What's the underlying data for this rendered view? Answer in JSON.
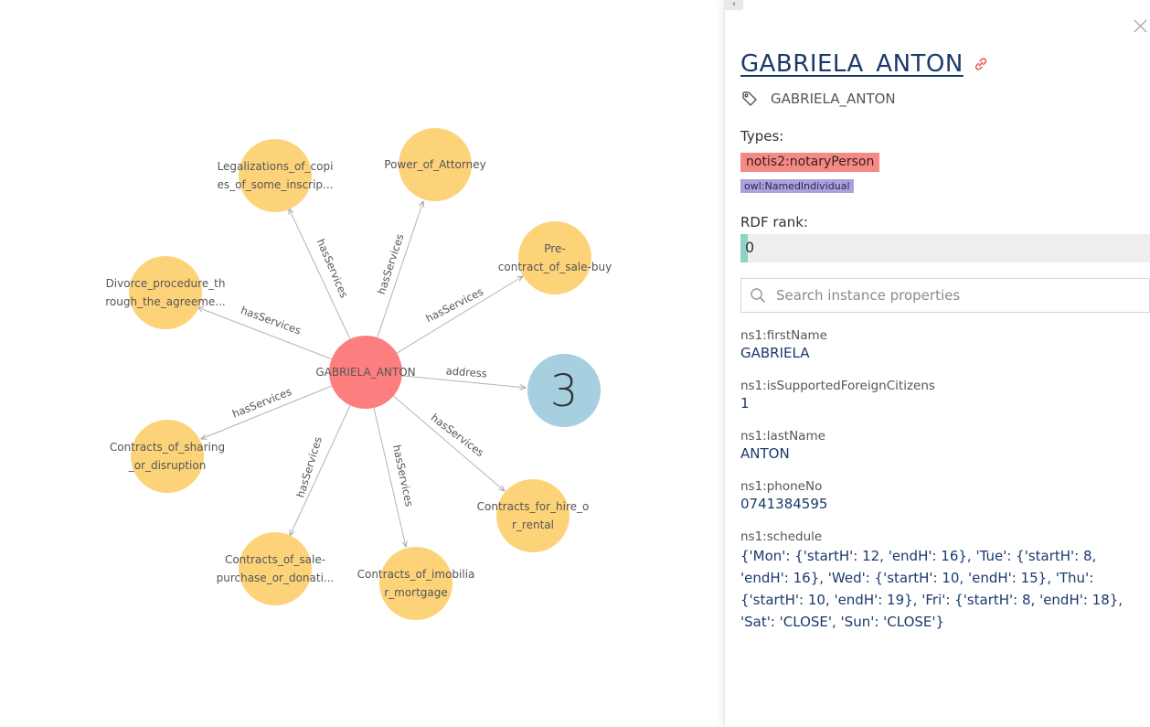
{
  "graph": {
    "center": {
      "label": "GABRIELA_ANTON",
      "color": "#fd7e7f"
    },
    "count_node": {
      "label": "3",
      "color": "#a6cfe0"
    },
    "service_color": "#fdd37a",
    "edge_color": "#b3b3b3",
    "service_nodes": [
      {
        "id": "legal",
        "lines": [
          "Legalizations_of_copi",
          "es_of_some_inscrip..."
        ],
        "edge": "hasServices"
      },
      {
        "id": "poa",
        "lines": [
          "Power_of_Attorney"
        ],
        "edge": "hasServices"
      },
      {
        "id": "pre",
        "lines": [
          "Pre-",
          "contract_of_sale-buy"
        ],
        "edge": "hasServices"
      },
      {
        "id": "divorce",
        "lines": [
          "Divorce_procedure_th",
          "rough_the_agreeme..."
        ],
        "edge": "hasServices"
      },
      {
        "id": "sharing",
        "lines": [
          "Contracts_of_sharing",
          "_or_disruption"
        ],
        "edge": "hasServices"
      },
      {
        "id": "sale",
        "lines": [
          "Contracts_of_sale-",
          "purchase_or_donati..."
        ],
        "edge": "hasServices"
      },
      {
        "id": "imobil",
        "lines": [
          "Contracts_of_imobilia",
          "r_mortgage"
        ],
        "edge": "hasServices"
      },
      {
        "id": "hire",
        "lines": [
          "Contracts_for_hire_o",
          "r_rental"
        ],
        "edge": "hasServices"
      }
    ],
    "address_edge": "address"
  },
  "panel": {
    "title": "GABRIELA_ANTON",
    "label": "GABRIELA_ANTON",
    "types_heading": "Types:",
    "types": [
      "notis2:notaryPerson",
      "owl:NamedIndividual"
    ],
    "rank_heading": "RDF rank:",
    "rank_value": "0",
    "search_placeholder": "Search instance properties",
    "properties": [
      {
        "name": "ns1:firstName",
        "value": "GABRIELA"
      },
      {
        "name": "ns1:isSupportedForeignCitizens",
        "value": "1"
      },
      {
        "name": "ns1:lastName",
        "value": "ANTON"
      },
      {
        "name": "ns1:phoneNo",
        "value": "0741384595"
      },
      {
        "name": "ns1:schedule",
        "value": "{'Mon': {'startH': 12, 'endH': 16}, 'Tue': {'startH': 8, 'endH': 16}, 'Wed': {'startH': 10, 'endH': 15}, 'Thu': {'startH': 10, 'endH': 19}, 'Fri': {'startH': 8, 'endH': 18}, 'Sat': 'CLOSE', 'Sun': 'CLOSE'}"
      }
    ],
    "icons": {
      "close": "close-icon",
      "link": "link-icon",
      "tag": "tag-icon",
      "search": "search-icon",
      "collapse": "chevron-left-icon"
    },
    "link_color": "#e05b5b"
  }
}
